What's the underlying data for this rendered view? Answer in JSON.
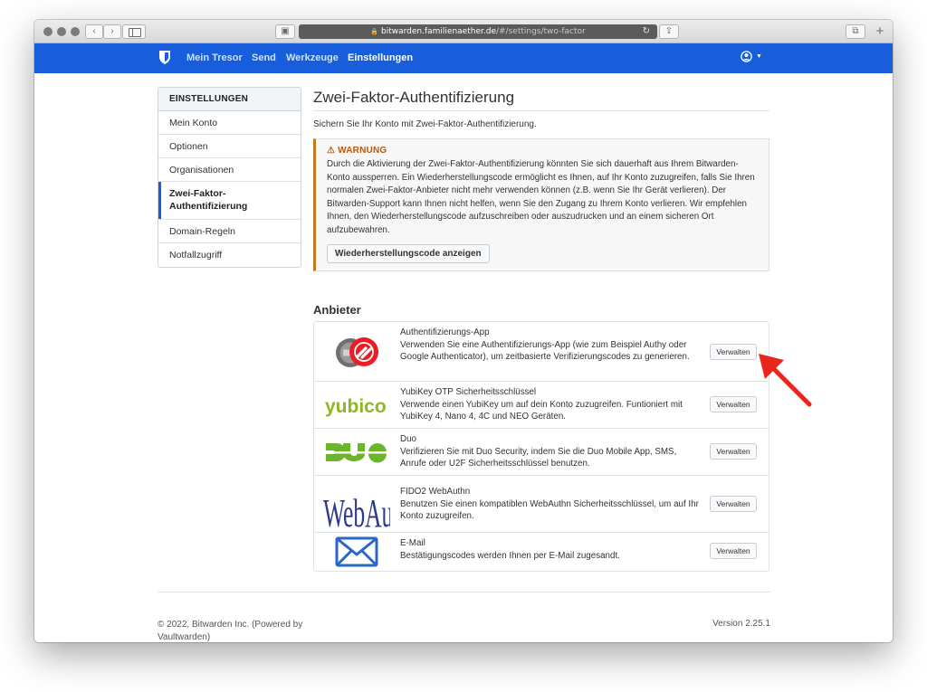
{
  "browser": {
    "address_host": "bitwarden.familienaether.de",
    "address_path": "/#/settings/two-factor"
  },
  "navbar": {
    "items": [
      {
        "label": "Mein Tresor",
        "active": false
      },
      {
        "label": "Send",
        "active": false
      },
      {
        "label": "Werkzeuge",
        "active": false
      },
      {
        "label": "Einstellungen",
        "active": true
      }
    ],
    "account_icon": "user-circle-icon"
  },
  "sidebar": {
    "heading": "EINSTELLUNGEN",
    "items": [
      {
        "label": "Mein Konto",
        "active": false
      },
      {
        "label": "Optionen",
        "active": false
      },
      {
        "label": "Organisationen",
        "active": false
      },
      {
        "label": "Zwei-Faktor-Authentifizierung",
        "active": true
      },
      {
        "label": "Domain-Regeln",
        "active": false
      },
      {
        "label": "Notfallzugriff",
        "active": false
      }
    ]
  },
  "page": {
    "title": "Zwei-Faktor-Authentifizierung",
    "lead": "Sichern Sie Ihr Konto mit Zwei-Faktor-Authentifizierung.",
    "warning": {
      "title": "WARNUNG",
      "icon": "warning-triangle-icon",
      "body": "Durch die Aktivierung der Zwei-Faktor-Authentifizierung könnten Sie sich dauerhaft aus Ihrem Bitwarden-Konto aussperren. Ein Wiederherstellungscode ermöglicht es Ihnen, auf Ihr Konto zuzugreifen, falls Sie Ihren normalen Zwei-Faktor-Anbieter nicht mehr verwenden können (z.B. wenn Sie Ihr Gerät verlieren). Der Bitwarden-Support kann Ihnen nicht helfen, wenn Sie den Zugang zu Ihrem Konto verlieren. Wir empfehlen Ihnen, den Wiederherstellungscode aufzuschreiben oder auszudrucken und an einem sicheren Ort aufzubewahren.",
      "button_label": "Wiederherstellungscode anzeigen"
    },
    "providers_title": "Anbieter",
    "providers": [
      {
        "logo": "authenticator-app-logo",
        "name": "Authentifizierungs-App",
        "description": "Verwenden Sie eine Authentifizierungs-App (wie zum Beispiel Authy oder Google Authenticator), um zeitbasierte Verifizierungscodes zu generieren.",
        "button": "Verwalten"
      },
      {
        "logo": "yubico-logo",
        "logo_text": "yubico",
        "name": "YubiKey OTP Sicherheitsschlüssel",
        "description": "Verwende einen YubiKey um auf dein Konto zuzugreifen. Funtioniert mit YubiKey 4, Nano 4, 4C und NEO Geräten.",
        "button": "Verwalten"
      },
      {
        "logo": "duo-logo",
        "name": "Duo",
        "description": "Verifizieren Sie mit Duo Security, indem Sie die Duo Mobile App, SMS, Anrufe oder U2F Sicherheitsschlüssel benutzen.",
        "button": "Verwalten"
      },
      {
        "logo": "webauthn-logo",
        "logo_text": "WebAuthn",
        "name": "FIDO2 WebAuthn",
        "description": "Benutzen Sie einen kompatiblen WebAuthn Sicherheitsschlüssel, um auf Ihr Konto zuzugreifen.",
        "button": "Verwalten"
      },
      {
        "logo": "envelope-icon",
        "name": "E-Mail",
        "description": "Bestätigungscodes werden Ihnen per E-Mail zugesandt.",
        "button": "Verwalten"
      }
    ]
  },
  "footer": {
    "copyright": "© 2022, Bitwarden Inc. (Powered by Vaultwarden)",
    "version": "Version 2.25.1"
  },
  "colors": {
    "brand_blue": "#175ddc",
    "warning_orange": "#c7781f",
    "annotation_red": "#e8261d",
    "yubico_green": "#8fb721",
    "duo_green": "#6cb42c",
    "webauthn_navy": "#2d3a8c",
    "envelope_blue": "#2a67c8"
  }
}
